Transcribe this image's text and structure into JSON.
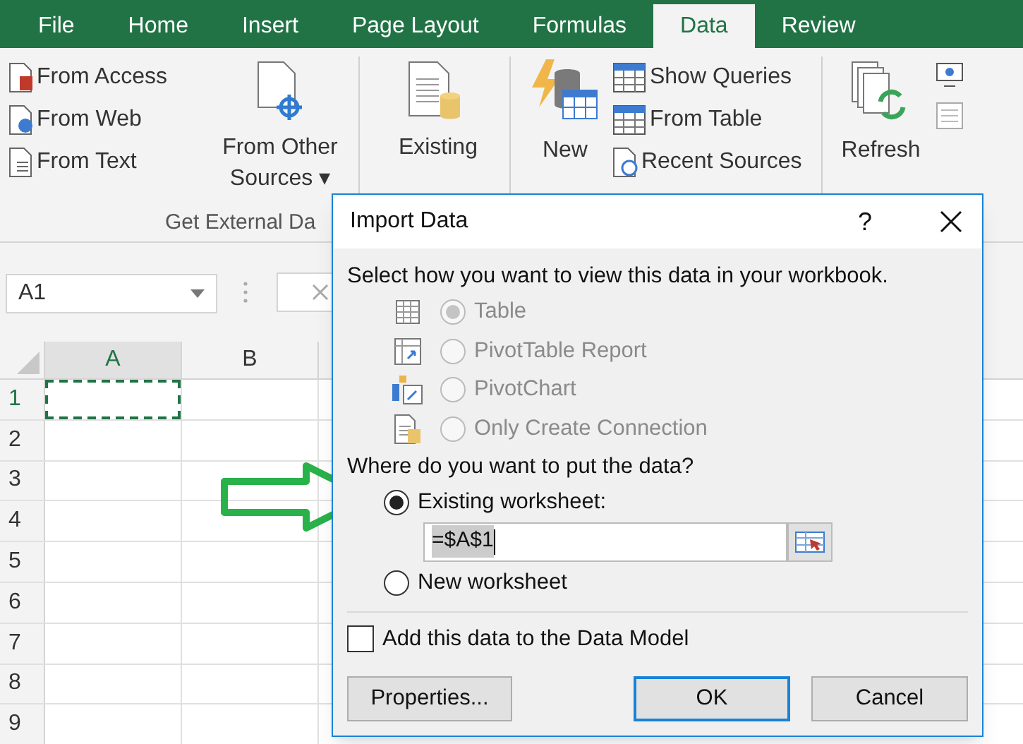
{
  "tabs": [
    {
      "label": "File",
      "selected": false
    },
    {
      "label": "Home",
      "selected": false
    },
    {
      "label": "Insert",
      "selected": false
    },
    {
      "label": "Page Layout",
      "selected": false
    },
    {
      "label": "Formulas",
      "selected": false
    },
    {
      "label": "Data",
      "selected": true
    },
    {
      "label": "Review",
      "selected": false
    }
  ],
  "ribbon": {
    "from_access": "From Access",
    "from_web": "From Web",
    "from_text": "From Text",
    "from_other_sources": [
      "From Other",
      "Sources ▾"
    ],
    "existing": "Existing",
    "new": "New",
    "show_queries": "Show Queries",
    "from_table": "From Table",
    "recent_sources": "Recent Sources",
    "refresh": "Refresh",
    "group_label": "Get External Da"
  },
  "name_box": "A1",
  "grid": {
    "columns": [
      "A",
      "B"
    ],
    "rows": [
      "1",
      "2",
      "3",
      "4",
      "5",
      "6",
      "7",
      "8",
      "9"
    ],
    "active_cell_copied": true
  },
  "dialog": {
    "title": "Import Data",
    "help": "?",
    "instruction": "Select how you want to view this data in your workbook.",
    "view_options": [
      {
        "label": "Table",
        "selected": true,
        "disabled": true
      },
      {
        "label": "PivotTable Report",
        "selected": false,
        "disabled": true
      },
      {
        "label": "PivotChart",
        "selected": false,
        "disabled": true
      },
      {
        "label": "Only Create Connection",
        "selected": false,
        "disabled": true
      }
    ],
    "location_prompt": "Where do you want to put the data?",
    "location_options": [
      {
        "label": "Existing worksheet:",
        "selected": true
      },
      {
        "label": "New worksheet",
        "selected": false
      }
    ],
    "reference": "=$A$1",
    "data_model": {
      "label": "Add this data to the Data Model",
      "checked": false
    },
    "buttons": [
      {
        "label": "Properties...",
        "default": false
      },
      {
        "label": "OK",
        "default": true
      },
      {
        "label": "Cancel",
        "default": false
      }
    ]
  }
}
